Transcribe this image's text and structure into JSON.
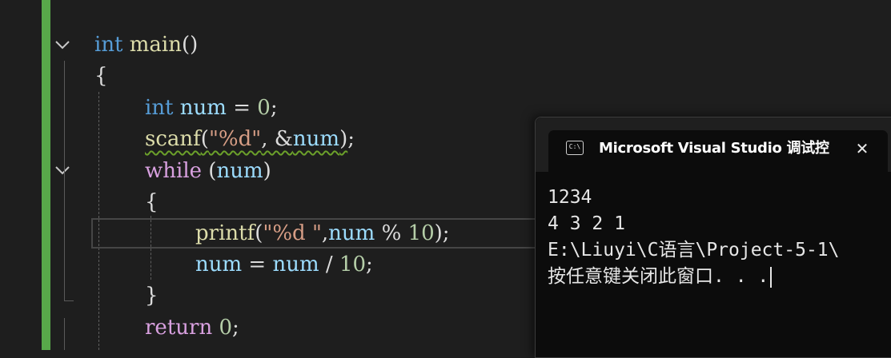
{
  "editor": {
    "lines": {
      "l1_kw": "int",
      "l1_fn": "main",
      "l1_p": "()",
      "l2": "{",
      "l3_kw": "int",
      "l3_var": "num",
      "l3_op": " = ",
      "l3_num": "0",
      "l3_end": ";",
      "l4_fn": "scanf",
      "l4_p1": "(",
      "l4_str": "\"%d\"",
      "l4_comma": ", &",
      "l4_var": "num",
      "l4_p2": ")",
      "l4_end": ";",
      "l5_kw": "while",
      "l5_p1": " (",
      "l5_var": "num",
      "l5_p2": ")",
      "l6": "{",
      "l7_fn": "printf",
      "l7_p1": "(",
      "l7_str": "\"%d \"",
      "l7_comma": ",",
      "l7_var": "num",
      "l7_op": " % ",
      "l7_num": "10",
      "l7_end": ");",
      "l8_var1": "num",
      "l8_op1": " = ",
      "l8_var2": "num",
      "l8_op2": " / ",
      "l8_num": "10",
      "l8_end": ";",
      "l9": "}",
      "l10_kw": "return",
      "l10_sp": " ",
      "l10_num": "0",
      "l10_end": ";"
    }
  },
  "console": {
    "icon_text": "C:\\",
    "title": "Microsoft Visual Studio 调试控",
    "close": "✕",
    "output": [
      "1234",
      "4 3 2 1",
      "E:\\Liuyi\\C语言\\Project-5-1\\",
      "按任意键关闭此窗口. . ."
    ]
  },
  "colors": {
    "keyword": "#569cd6",
    "control_keyword": "#d8a0df",
    "function": "#dcdcaa",
    "variable": "#9cdcfe",
    "number": "#b5cea8",
    "string": "#d69d85",
    "change_bar": "#58a84a"
  }
}
